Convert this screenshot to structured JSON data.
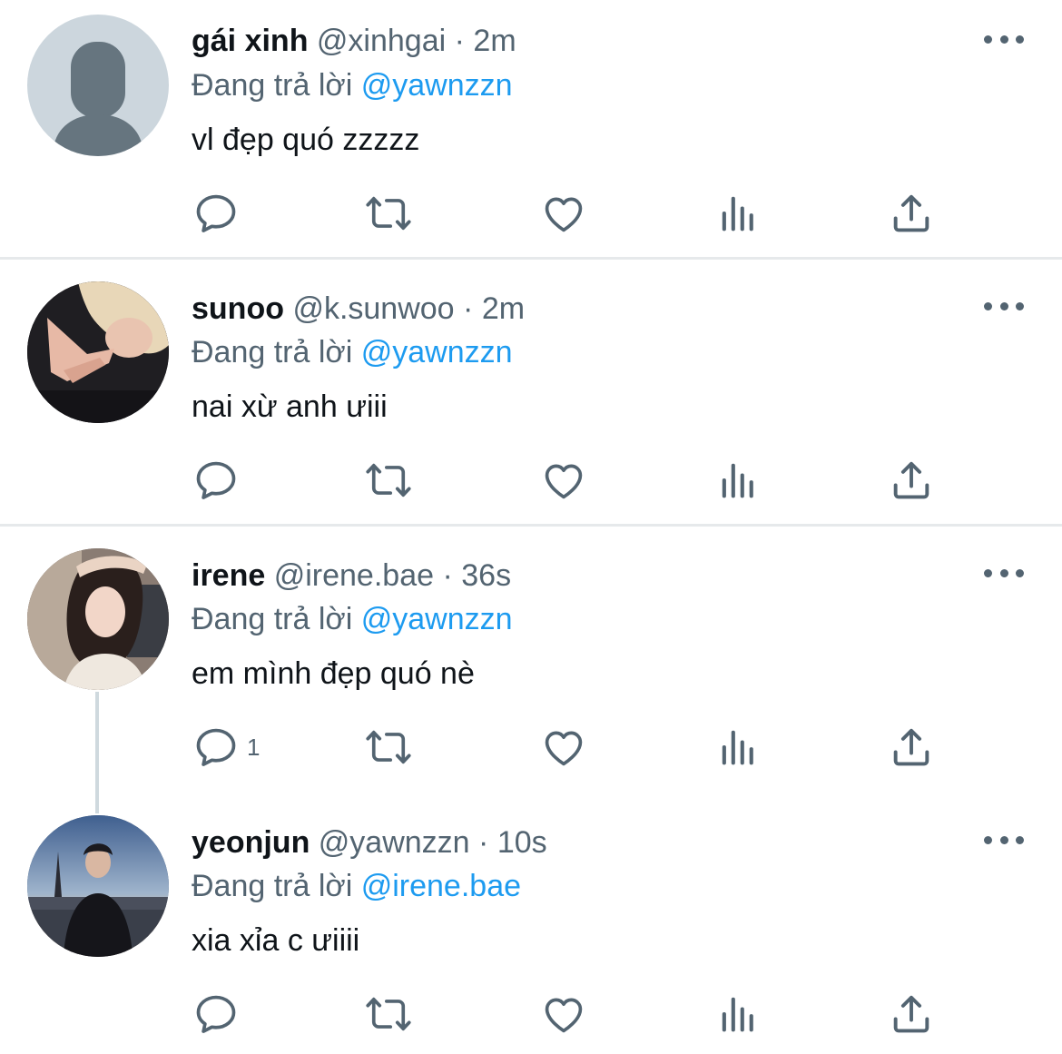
{
  "tweets": [
    {
      "name": "gái xinh",
      "handle": "@xinhgai",
      "dot": "·",
      "time": "2m",
      "replying_prefix": "Đang trả lời",
      "replying_to": "@yawnzzn",
      "text": "vl đẹp quó zzzzz",
      "reply_count": ""
    },
    {
      "name": "sunoo",
      "handle": "@k.sunwoo",
      "dot": "·",
      "time": "2m",
      "replying_prefix": "Đang trả lời",
      "replying_to": "@yawnzzn",
      "text": "nai xừ anh ưiii",
      "reply_count": ""
    },
    {
      "name": "irene",
      "handle": "@irene.bae",
      "dot": "·",
      "time": "36s",
      "replying_prefix": "Đang trả lời",
      "replying_to": "@yawnzzn",
      "text": "em mình đẹp quó nè",
      "reply_count": "1"
    },
    {
      "name": "yeonjun",
      "handle": "@yawnzzn",
      "dot": "·",
      "time": "10s",
      "replying_prefix": "Đang trả lời",
      "replying_to": "@irene.bae",
      "text": "xia xỉa c ưiiii",
      "reply_count": ""
    }
  ],
  "icons": {
    "reply": "reply-icon",
    "retweet": "retweet-icon",
    "like": "heart-icon",
    "views": "views-icon",
    "share": "share-icon",
    "more": "more-icon"
  },
  "colors": {
    "text": "#0f1419",
    "secondary": "#536471",
    "mention": "#1d9bf0",
    "separator": "#e6e9eb"
  }
}
